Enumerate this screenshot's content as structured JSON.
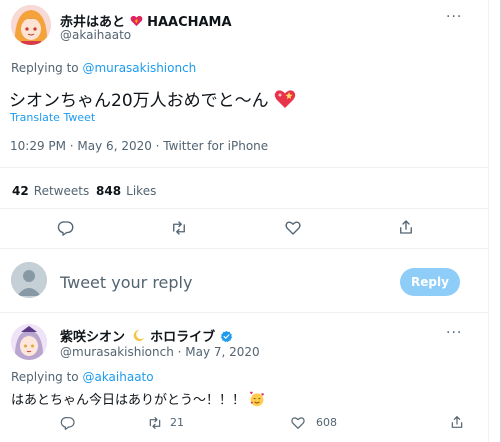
{
  "main_tweet": {
    "display_name": "赤井はあと",
    "display_name_suffix": "HAACHAMA",
    "handle": "@akaihaato",
    "replying_prefix": "Replying to ",
    "replying_to": "@murasakishionch",
    "text": "シオンちゃん20万人おめでと〜ん",
    "translate_label": "Translate Tweet",
    "timestamp": "10:29 PM · May 6, 2020 · Twitter for iPhone",
    "retweets_count": "42",
    "retweets_label": "Retweets",
    "likes_count": "848",
    "likes_label": "Likes",
    "more_label": "···"
  },
  "compose": {
    "placeholder": "Tweet your reply",
    "reply_button": "Reply"
  },
  "reply_tweet": {
    "display_name": "紫咲シオン",
    "display_name_suffix": "ホロライブ",
    "handle_date": "@murasakishionch · May 7, 2020",
    "replying_prefix": "Replying to ",
    "replying_to": "@akaihaato",
    "text": "はあとちゃん今日はありがとう〜！！！",
    "retweet_count": "21",
    "like_count": "608",
    "more_label": "···"
  },
  "colors": {
    "accent": "#1d9bf0",
    "reply_button_disabled": "#8ecdf8",
    "text_secondary": "#536471",
    "divider": "#eff3f4"
  },
  "icons": [
    "reply-icon",
    "retweet-icon",
    "like-icon",
    "share-icon",
    "verified-badge-icon",
    "heart-emoji-icon",
    "smiling-hearts-emoji-icon",
    "crescent-moon-icon"
  ]
}
